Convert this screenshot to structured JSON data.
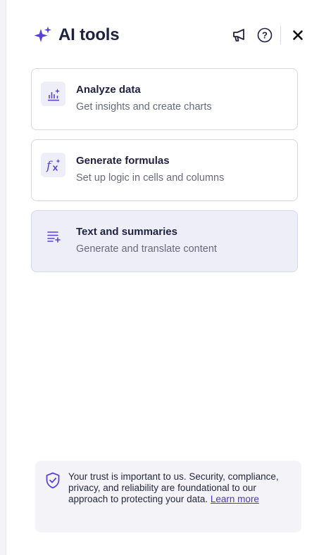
{
  "header": {
    "title": "AI tools",
    "icons": [
      "sparkle-icon",
      "announcement-icon",
      "help-icon",
      "close-icon"
    ]
  },
  "tools": [
    {
      "title": "Analyze data",
      "subtitle": "Get insights and create charts",
      "icon": "chart-sparkle-icon",
      "selected": false
    },
    {
      "title": "Generate formulas",
      "subtitle": "Set up logic in cells and columns",
      "icon": "formula-icon",
      "selected": false
    },
    {
      "title": "Text and summaries",
      "subtitle": "Generate and translate content",
      "icon": "text-lines-icon",
      "selected": true
    }
  ],
  "trust": {
    "message": "Your trust is important to us. Security, compliance, privacy, and reliability are foundational to our approach to protecting your data.",
    "link_label": "Learn more",
    "icon": "shield-check-icon"
  },
  "colors": {
    "accent": "#5b3fdc",
    "title": "#1f2140",
    "subtitle": "#676a7e",
    "selected_bg": "#eeeef9",
    "card_border": "#d6d7de"
  }
}
